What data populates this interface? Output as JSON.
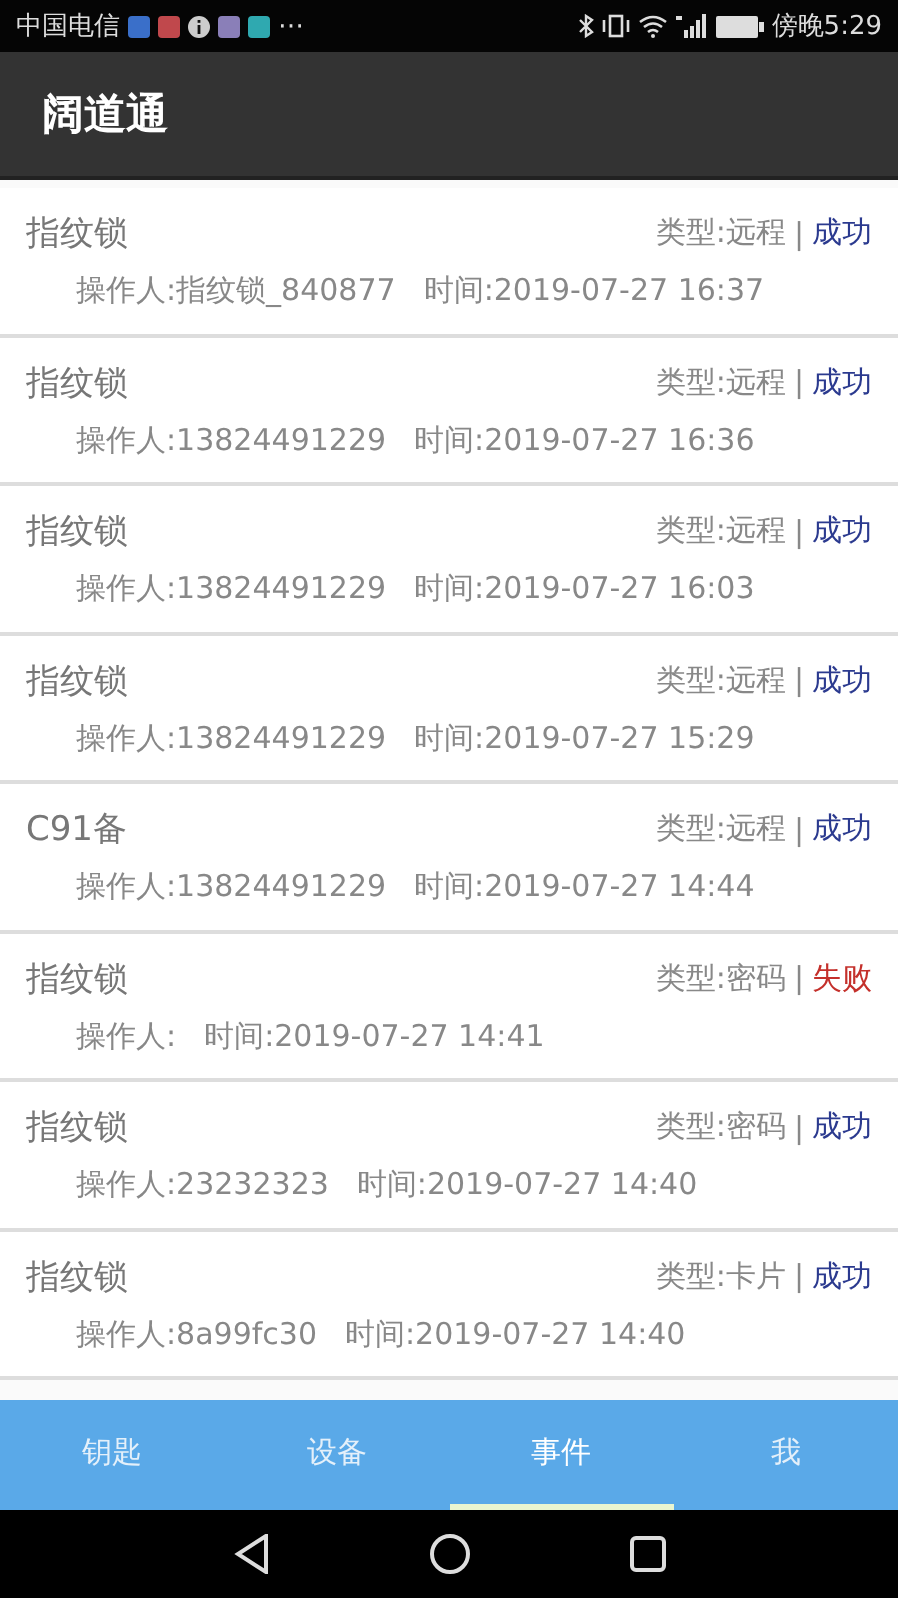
{
  "status_bar": {
    "carrier": "中国电信",
    "more": "⋯",
    "time": "傍晚5:29"
  },
  "app_bar": {
    "title": "阔道通"
  },
  "events": [
    {
      "name": "指纹锁",
      "type": "类型:远程",
      "separator": "|",
      "result": "成功",
      "failed": false,
      "operator": "操作人:指纹锁_840877",
      "time": "时间:2019-07-27 16:37"
    },
    {
      "name": "指纹锁",
      "type": "类型:远程",
      "separator": "|",
      "result": "成功",
      "failed": false,
      "operator": "操作人:13824491229",
      "time": "时间:2019-07-27 16:36"
    },
    {
      "name": "指纹锁",
      "type": "类型:远程",
      "separator": "|",
      "result": "成功",
      "failed": false,
      "operator": "操作人:13824491229",
      "time": "时间:2019-07-27 16:03"
    },
    {
      "name": "指纹锁",
      "type": "类型:远程",
      "separator": "|",
      "result": "成功",
      "failed": false,
      "operator": "操作人:13824491229",
      "time": "时间:2019-07-27 15:29"
    },
    {
      "name": "C91备",
      "type": "类型:远程",
      "separator": "|",
      "result": "成功",
      "failed": false,
      "operator": "操作人:13824491229",
      "time": "时间:2019-07-27 14:44"
    },
    {
      "name": "指纹锁",
      "type": "类型:密码",
      "separator": "|",
      "result": "失败",
      "failed": true,
      "operator": "操作人:",
      "time": "时间:2019-07-27 14:41"
    },
    {
      "name": "指纹锁",
      "type": "类型:密码",
      "separator": "|",
      "result": "成功",
      "failed": false,
      "operator": "操作人:23232323",
      "time": "时间:2019-07-27 14:40"
    },
    {
      "name": "指纹锁",
      "type": "类型:卡片",
      "separator": "|",
      "result": "成功",
      "failed": false,
      "operator": "操作人:8a99fc30",
      "time": "时间:2019-07-27 14:40"
    }
  ],
  "tabs": [
    {
      "label": "钥匙",
      "selected": false
    },
    {
      "label": "设备",
      "selected": false
    },
    {
      "label": "事件",
      "selected": true
    },
    {
      "label": "我",
      "selected": false
    }
  ]
}
